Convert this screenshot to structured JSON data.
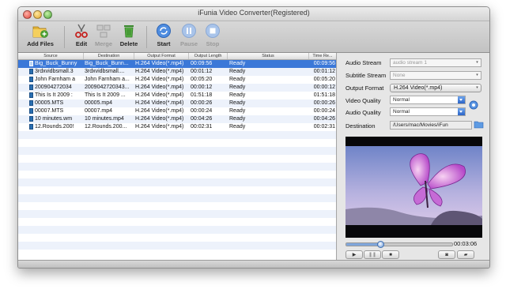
{
  "window": {
    "title": "iFunia Video Converter(Registered)"
  },
  "toolbar": {
    "add_files": "Add Files",
    "edit": "Edit",
    "merge": "Merge",
    "delete": "Delete",
    "start": "Start",
    "pause": "Pause",
    "stop": "Stop"
  },
  "list": {
    "headers": [
      "Source",
      "Destination",
      "Output Format",
      "Output Length",
      "Status",
      "Time Re..."
    ],
    "rows": [
      {
        "source": "Big_Buck_Bunny",
        "destination": "Big_Buck_Bunn...",
        "format": "H.264 Video(*.mp4)",
        "length": "00:09:56",
        "status": "Ready",
        "time": "00:09:56",
        "selected": true
      },
      {
        "source": "3rdxvidbsmall.3",
        "destination": "3rdxvidbsmall....",
        "format": "H.264 Video(*.mp4)",
        "length": "00:01:12",
        "status": "Ready",
        "time": "00:01:12",
        "selected": false
      },
      {
        "source": "John Farnham a",
        "destination": "John Farnham a...",
        "format": "H.264 Video(*.mp4)",
        "length": "00:05:20",
        "status": "Ready",
        "time": "00:05:20",
        "selected": false
      },
      {
        "source": "200904272034",
        "destination": "2009042720343...",
        "format": "H.264 Video(*.mp4)",
        "length": "00:00:12",
        "status": "Ready",
        "time": "00:00:12",
        "selected": false
      },
      {
        "source": "This Is It 2009 :",
        "destination": "This Is It 2009 ...",
        "format": "H.264 Video(*.mp4)",
        "length": "01:51:18",
        "status": "Ready",
        "time": "01:51:18",
        "selected": false
      },
      {
        "source": "00005.MTS",
        "destination": "00005.mp4",
        "format": "H.264 Video(*.mp4)",
        "length": "00:00:26",
        "status": "Ready",
        "time": "00:00:26",
        "selected": false
      },
      {
        "source": "00007.MTS",
        "destination": "00007.mp4",
        "format": "H.264 Video(*.mp4)",
        "length": "00:00:24",
        "status": "Ready",
        "time": "00:00:24",
        "selected": false
      },
      {
        "source": "10 minutes.wm",
        "destination": "10 minutes.mp4",
        "format": "H.264 Video(*.mp4)",
        "length": "00:04:26",
        "status": "Ready",
        "time": "00:04:26",
        "selected": false
      },
      {
        "source": "12.Rounds.200!",
        "destination": "12.Rounds.200...",
        "format": "H.264 Video(*.mp4)",
        "length": "00:02:31",
        "status": "Ready",
        "time": "00:02:31",
        "selected": false
      }
    ]
  },
  "panel": {
    "audio_stream_label": "Audio Stream",
    "audio_stream_value": "audio stream 1",
    "subtitle_stream_label": "Subtitle Stream",
    "subtitle_stream_value": "None",
    "output_format_label": "Output Format",
    "output_format_value": "H.264 Video(*.mp4)",
    "video_quality_label": "Video Quality",
    "video_quality_value": "Normal",
    "audio_quality_label": "Audio Quality",
    "audio_quality_value": "Normal",
    "destination_label": "Destination",
    "destination_value": "/Users/mac/Movies/iFun",
    "playback_time": "00:03:06",
    "playback_progress": 0.32
  },
  "colors": {
    "selection": "#3b78d8",
    "row_alt": "#edf2fb"
  },
  "icons": [
    "add-files-icon",
    "edit-scissors-icon",
    "merge-icon",
    "delete-trash-icon",
    "start-icon",
    "pause-icon",
    "stop-icon",
    "settings-gear-icon",
    "folder-icon",
    "play-icon",
    "pause-small-icon",
    "stop-small-icon",
    "snapshot-icon",
    "open-folder-icon"
  ]
}
